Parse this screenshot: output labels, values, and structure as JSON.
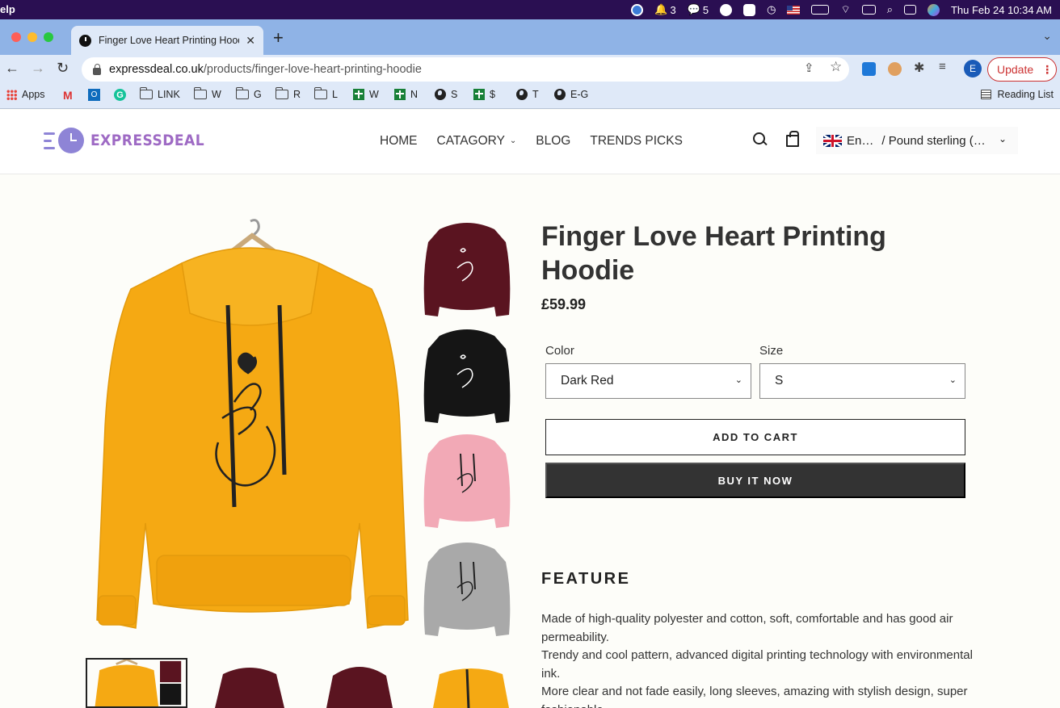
{
  "os_menubar": {
    "app_fragment": "elp",
    "notifications_count": "3",
    "chat_count": "5",
    "datetime": "Thu Feb 24  10:34 AM"
  },
  "browser": {
    "tab_title": "Finger Love Heart Printing Hoodie",
    "url_domain": "expressdeal.co.uk",
    "url_path": "/products/finger-love-heart-printing-hoodie",
    "profile_initial": "E",
    "update_label": "Update",
    "bookmarks": [
      "Apps",
      "LINK",
      "W",
      "G",
      "R",
      "L",
      "W",
      "N",
      "S",
      "$",
      "T",
      "E-G"
    ],
    "reading_list": "Reading List"
  },
  "site": {
    "brand": "EXPRESSDEAL",
    "nav": {
      "home": "HOME",
      "category": "CATAGORY",
      "blog": "BLOG",
      "trends": "TRENDS PICKS"
    },
    "locale": {
      "language": "En…",
      "currency": "/ Pound sterling (…"
    }
  },
  "product": {
    "title": "Finger Love Heart Printing Hoodie",
    "price": "£59.99",
    "color_label": "Color",
    "color_value": "Dark Red",
    "size_label": "Size",
    "size_value": "S",
    "add_to_cart": "ADD TO CART",
    "buy_now": "BUY IT NOW",
    "feature_heading": "FEATURE",
    "features": [
      "Made of high-quality polyester and cotton, soft, comfortable and has good air permeability.",
      "Trendy and cool pattern, advanced digital printing technology with environmental ink.",
      "More clear and not fade easily, long sleeves, amazing with stylish design, super fashionable."
    ],
    "swatch_colors": {
      "main": "#f5a913",
      "dark_red": "#5a1420",
      "black": "#151515",
      "pink": "#f2a9b6",
      "grey": "#a9a9a9"
    }
  }
}
